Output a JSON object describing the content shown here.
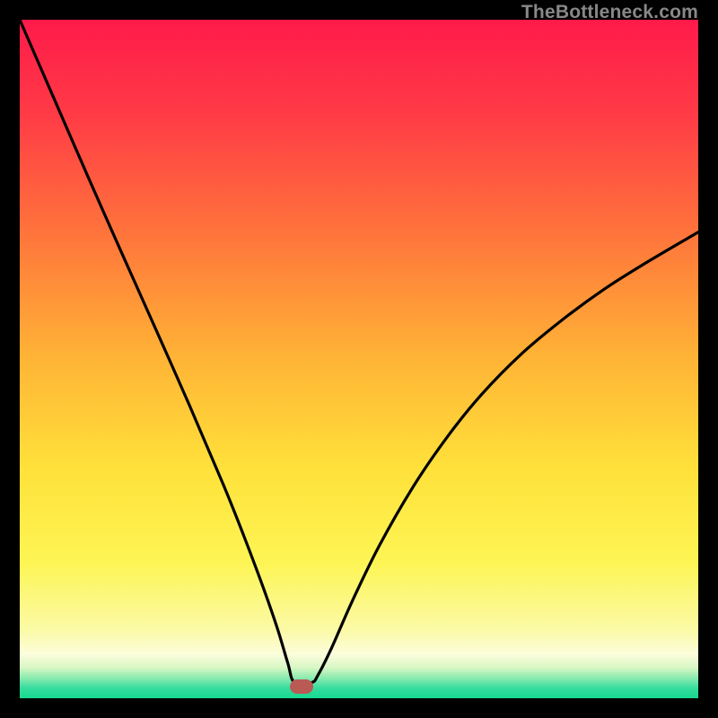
{
  "watermark": {
    "text": "TheBottleneck.com"
  },
  "gradient": {
    "stops": [
      {
        "pct": 0,
        "color": "#ff1a4a"
      },
      {
        "pct": 14,
        "color": "#ff3b46"
      },
      {
        "pct": 30,
        "color": "#ff6f3c"
      },
      {
        "pct": 50,
        "color": "#ffb436"
      },
      {
        "pct": 66,
        "color": "#ffe13a"
      },
      {
        "pct": 80,
        "color": "#fdf554"
      },
      {
        "pct": 90,
        "color": "#fbfaa7"
      },
      {
        "pct": 93.5,
        "color": "#fcfddc"
      },
      {
        "pct": 95.5,
        "color": "#d7f7c4"
      },
      {
        "pct": 97,
        "color": "#8bebb0"
      },
      {
        "pct": 98.5,
        "color": "#36dd9e"
      },
      {
        "pct": 100,
        "color": "#16d98f"
      }
    ]
  },
  "chart_data": {
    "type": "line",
    "title": "",
    "xlabel": "",
    "ylabel": "",
    "xlim": [
      0,
      100
    ],
    "ylim": [
      0,
      100
    ],
    "series": [
      {
        "name": "bottleneck-curve",
        "x": [
          0,
          5,
          10,
          15,
          20,
          25,
          30,
          33,
          36,
          38,
          39.5,
          40.5,
          43,
          44,
          46,
          49,
          53,
          58,
          63,
          68,
          74,
          80,
          86,
          92,
          100
        ],
        "y": [
          100,
          88.5,
          77,
          65.7,
          54.5,
          43.2,
          31.5,
          24,
          16,
          10.2,
          5.2,
          2.3,
          2.3,
          3.5,
          7.5,
          14.3,
          22.5,
          31.2,
          38.5,
          44.7,
          50.8,
          55.8,
          60.2,
          64,
          68.7
        ]
      }
    ],
    "marker": {
      "x": 41.5,
      "y": 1.7,
      "color": "#ba5a55"
    }
  },
  "plot": {
    "inner_width": 756,
    "inner_height": 756,
    "curve_stroke": "#000000",
    "curve_width": 3.2
  }
}
